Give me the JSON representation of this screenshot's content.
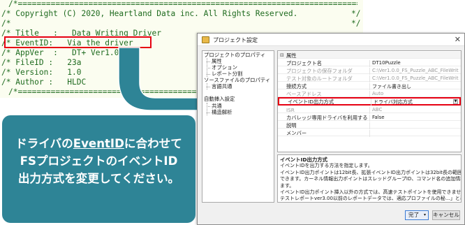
{
  "code": {
    "comment_open": "/*",
    "comment_close": "*/",
    "lines": [
      {
        "prefix": "/*",
        "text": " Copyright (C) 2020, Heartland Data inc. All Rights Reserved.",
        "suffix": "*/"
      },
      {
        "prefix": "/*",
        "text": "",
        "suffix": "*/"
      },
      {
        "prefix": "/*",
        "text": " Title   :   Data Writing Driver",
        "suffix": ""
      },
      {
        "prefix": "/*",
        "text": " EventID:   Via the driver",
        "suffix": ""
      },
      {
        "prefix": "/*",
        "text": " AppVer  :   DT+ Ver1.00-",
        "suffix": ""
      },
      {
        "prefix": "/*",
        "text": " FileID :   23a",
        "suffix": ""
      },
      {
        "prefix": "/*",
        "text": " Version:   1.0",
        "suffix": ""
      },
      {
        "prefix": "/*",
        "text": " Author :   HLDC",
        "suffix": ""
      }
    ]
  },
  "dialog": {
    "title": "プロジェクト設定",
    "close_glyph": "✕",
    "tree": {
      "items": [
        {
          "label": "プロジェクトのプロパティ"
        },
        {
          "label": "属性"
        },
        {
          "label": "オプション"
        },
        {
          "label": "レポート分割"
        },
        {
          "label": "ソースファイルのプロパティ"
        },
        {
          "label": "言語共通"
        },
        {
          "label": "自動挿入設定"
        },
        {
          "label": "共通"
        },
        {
          "label": "構造解析"
        }
      ]
    },
    "grid": {
      "category_toggle": "⊟",
      "category": "属性",
      "rows": [
        {
          "name": "プロジェクト名",
          "value": "DT10Puzzle"
        },
        {
          "name": "プロジェクトの保存フォルダ",
          "value": "C:\\Ver1.0.0_FS_Puzzle_ABC_FileWriting\\FS..."
        },
        {
          "name": "テスト対象のルートフォルダ",
          "value": "C:\\Ver1.0.0_FS_Puzzle_ABC_FileWriting\\DT..."
        },
        {
          "name": "接続方式",
          "value": "ファイル書き出し"
        },
        {
          "name": "ベースアドレス",
          "value": "Auto"
        },
        {
          "name": "イベントID出力方式",
          "value": "ドライバ対応方式"
        },
        {
          "name": "ISR",
          "value": "ABC"
        },
        {
          "name": "カバレッジ専用ドライバを利用する",
          "value": "False"
        },
        {
          "name": "説明",
          "value": ""
        },
        {
          "name": "メンバー",
          "value": ""
        }
      ]
    },
    "description": {
      "title": "イベントID出力方式",
      "lines": [
        "イベントIDを出力する方法を指定します。",
        "イベントID出力ポイントは12bit長、拡張イベントID出力ポイントは32bit長の範囲で値を出力",
        "できます。カーネル情報出力ポイントはスレッドグループID、コマンド名の追加情報を出力でき",
        "ます。",
        "イベントID出力ポイント挿入以外の方式では、高速テストポイントを使用できません。",
        "テストレポートver3.00以前のレポートデータでは、適応プロファイルの秘…」と表記されます。"
      ]
    },
    "buttons": {
      "ok": "完了",
      "ok_caret": "▾",
      "cancel": "キャンセル"
    }
  },
  "callout": {
    "line1_pre": "ドライバの",
    "line1_ul": "EventID",
    "line1_post": "に合わせて",
    "line2": "FSプロジェクトのイベントID",
    "line3": "出力方式を変更してください。"
  },
  "colors": {
    "highlight": "#e60012",
    "callout": "#2e8496",
    "arrow": "#2e8496",
    "code_text": "#1f6b1f"
  }
}
